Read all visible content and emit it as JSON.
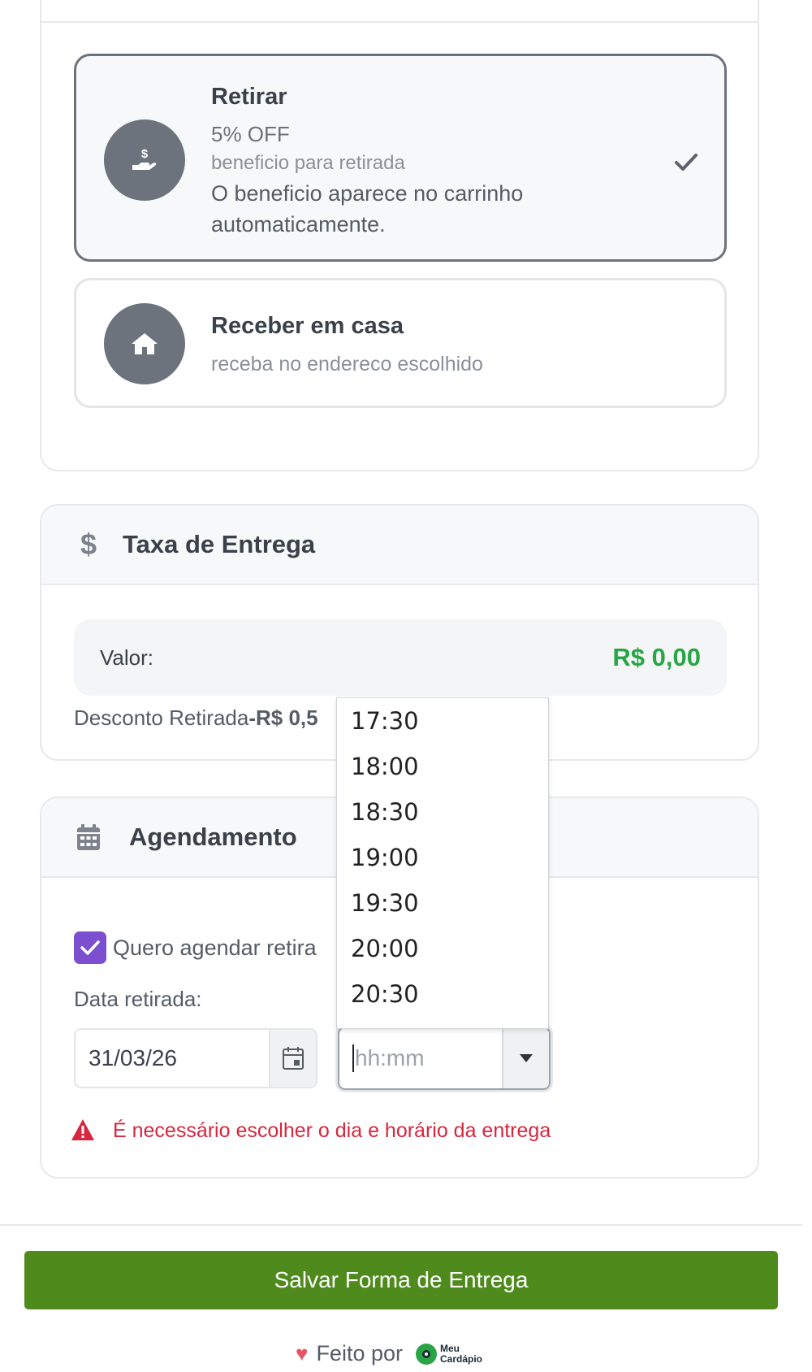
{
  "options": {
    "retirar": {
      "title": "Retirar",
      "discount": "5% OFF",
      "benefit": "beneficio para retirada",
      "note": "O beneficio aparece no carrinho automaticamente."
    },
    "receber": {
      "title": "Receber em casa",
      "subtitle": "receba no endereco escolhido"
    }
  },
  "taxa": {
    "title": "Taxa de Entrega",
    "valor_label": "Valor:",
    "valor": "R$ 0,00",
    "desconto_label": "Desconto Retirada",
    "desconto_value": "-R$ 0,5"
  },
  "agendamento": {
    "title": "Agendamento",
    "checkbox_label": "Quero agendar retira",
    "checkbox_checked": true,
    "data_label": "Data retirada:",
    "date_value": "31/03/26",
    "time_placeholder": "hh:mm",
    "error": "É necessário escolher o dia e horário da entrega"
  },
  "time_options": [
    "17:30",
    "18:00",
    "18:30",
    "19:00",
    "19:30",
    "20:00",
    "20:30"
  ],
  "footer": {
    "save_label": "Salvar Forma de Entrega",
    "made_by": "Feito por",
    "logo_top": "Meu",
    "logo_bottom": "Cardápio"
  },
  "colors": {
    "accent_green": "#2aa546",
    "button_green": "#4f8a1d",
    "checkbox_purple": "#7b4fcf",
    "error_red": "#d7263d"
  },
  "icons": {
    "retirar": "hand-dollar-icon",
    "receber": "home-icon",
    "taxa": "dollar-icon",
    "agenda": "calendar-icon",
    "selected": "check-icon"
  }
}
